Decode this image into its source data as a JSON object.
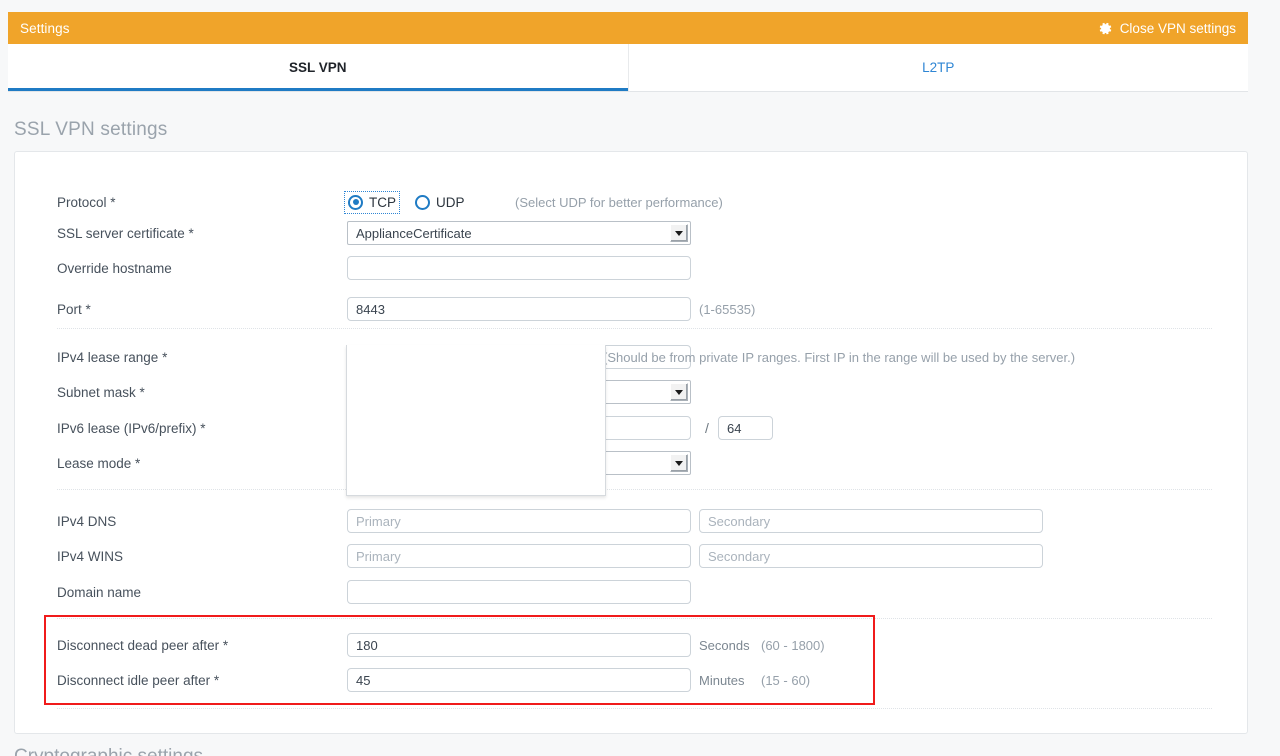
{
  "titlebar": {
    "title": "Settings",
    "close_label": "Close VPN settings",
    "gear_icon": "gear-icon",
    "bg_color": "#f0a42a"
  },
  "tabs": [
    {
      "label": "SSL VPN",
      "active": true
    },
    {
      "label": "L2TP",
      "active": false
    }
  ],
  "accent_color": "#1f7bc4",
  "section": {
    "title": "SSL VPN settings"
  },
  "form": {
    "protocol": {
      "label": "Protocol *",
      "options": [
        {
          "label": "TCP",
          "selected": true,
          "focused": true
        },
        {
          "label": "UDP",
          "selected": false,
          "focused": false
        }
      ],
      "hint": "(Select UDP for better performance)"
    },
    "ssl_server_certificate": {
      "label": "SSL server certificate *",
      "value": "ApplianceCertificate"
    },
    "override_hostname": {
      "label": "Override hostname",
      "value": ""
    },
    "port": {
      "label": "Port *",
      "value": "8443",
      "hint": "(1-65535)"
    },
    "ipv4_lease_range": {
      "label": "IPv4 lease range *",
      "value": "",
      "hint": "(Should be from private IP ranges. First IP in the range will be used by the server.)"
    },
    "subnet_mask": {
      "label": "Subnet mask *",
      "value": ""
    },
    "ipv6_lease": {
      "label": "IPv6 lease (IPv6/prefix) *",
      "value": "",
      "separator": "/",
      "prefix": "64"
    },
    "lease_mode": {
      "label": "Lease mode *",
      "value": ""
    },
    "ipv4_dns": {
      "label": "IPv4 DNS",
      "primary_placeholder": "Primary",
      "primary_value": "",
      "secondary_placeholder": "Secondary",
      "secondary_value": ""
    },
    "ipv4_wins": {
      "label": "IPv4 WINS",
      "primary_placeholder": "Primary",
      "primary_value": "",
      "secondary_placeholder": "Secondary",
      "secondary_value": ""
    },
    "domain_name": {
      "label": "Domain name",
      "value": ""
    },
    "disconnect_dead_peer": {
      "label": "Disconnect dead peer after *",
      "value": "180",
      "unit": "Seconds",
      "range": "(60 - 1800)"
    },
    "disconnect_idle_peer": {
      "label": "Disconnect idle peer after *",
      "value": "45",
      "unit": "Minutes",
      "range": "(15 - 60)"
    }
  },
  "highlight": {
    "color": "#f01b1b"
  },
  "bottom_heading": {
    "title": "Cryptographic settings"
  }
}
